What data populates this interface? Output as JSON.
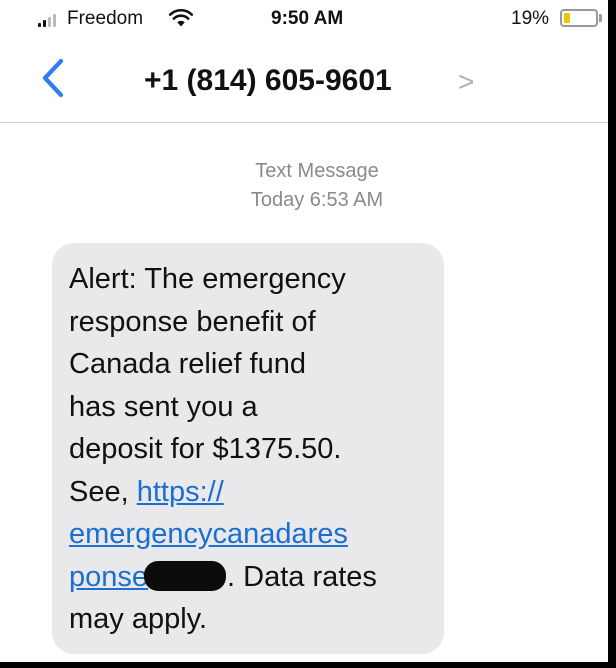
{
  "status_bar": {
    "carrier": "Freedom",
    "time": "9:50 AM",
    "battery_percent": "19%",
    "battery_level": 0.19,
    "wifi_icon": "wifi-icon",
    "signal_icon": "signal-bars-icon"
  },
  "nav": {
    "back_icon": "chevron-left-icon",
    "contact": "+1 (814) 605-9601",
    "detail_chevron": ">"
  },
  "thread": {
    "message_type": "Text Message",
    "timestamp": "Today 6:53 AM"
  },
  "message": {
    "line1": "Alert: The emergency",
    "line2": "response benefit of",
    "line3": "Canada relief fund",
    "line4": "has sent you a",
    "line5": "deposit for $1375.50.",
    "line6_prefix": "See, ",
    "link_part1": "https://",
    "link_part2": "emergencycanadares",
    "link_part3": "ponse",
    "line8_suffix": ". Data rates",
    "line9": "may apply."
  },
  "colors": {
    "link": "#1a6fd1",
    "bubble": "#e9e9eb",
    "ios_blue": "#2f7cf6",
    "battery_fill": "#f2c400"
  }
}
